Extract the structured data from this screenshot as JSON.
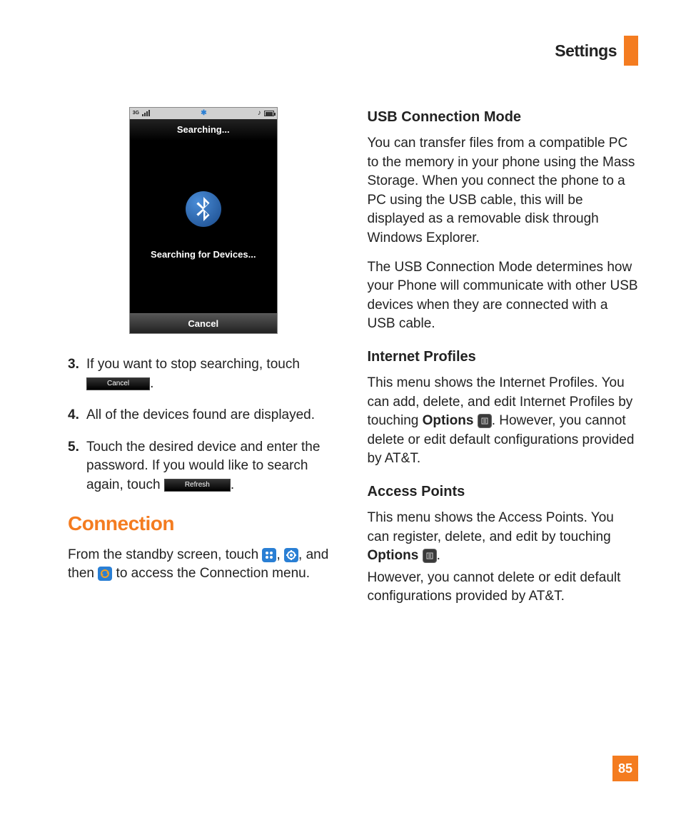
{
  "header": {
    "title": "Settings"
  },
  "phone": {
    "title": "Searching...",
    "message": "Searching for Devices...",
    "cancel": "Cancel",
    "status_3g": "3G",
    "bt_glyph": "✱",
    "music_glyph": "♪"
  },
  "steps": {
    "s3": {
      "num": "3.",
      "text": "If you want to stop searching, touch "
    },
    "s3_btn": "Cancel",
    "s4": {
      "num": "4.",
      "text": "All of the devices found are displayed."
    },
    "s5": {
      "num": "5.",
      "text_a": "Touch the desired device and enter the password. If you would like to search again, touch ",
      "btn": "Refresh",
      "text_b": "."
    }
  },
  "connection": {
    "heading": "Connection",
    "p1_a": "From the standby screen, touch ",
    "p1_b": ", ",
    "p1_c": ", and then ",
    "p1_d": " to access the Connection menu."
  },
  "right": {
    "usb_h": "USB Connection Mode",
    "usb_p1": "You can transfer files from a compatible PC to the memory in your phone using the Mass Storage. When you connect the phone to a PC using the USB cable, this will be displayed as a removable disk through Windows Explorer.",
    "usb_p2": "The USB Connection Mode determines how your Phone will communicate with other USB devices when they are connected with a USB cable.",
    "ip_h": "Internet Profiles",
    "ip_p_a": "This menu shows the Internet Profiles. You can add, delete, and edit Internet Profiles by touching ",
    "ip_options": "Options",
    "ip_p_b": ". However, you cannot delete or edit default configurations provided by AT&T.",
    "ap_h": "Access Points",
    "ap_p_a": "This menu shows the Access Points. You can register, delete, and edit by touching ",
    "ap_options": "Options",
    "ap_p_b": ".",
    "ap_p2": "However, you cannot delete or edit default configurations provided by AT&T."
  },
  "page_number": "85"
}
